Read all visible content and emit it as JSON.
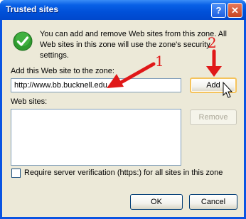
{
  "window": {
    "title": "Trusted sites",
    "help_label": "?",
    "close_label": "✕"
  },
  "info": {
    "icon": "check-circle-icon",
    "text": "You can add and remove Web sites from this zone. All Web sites in this zone will use the zone's security settings."
  },
  "add_section": {
    "label": "Add this Web site to the zone:",
    "url_value": "http://www.bb.bucknell.edu",
    "add_label": "Add"
  },
  "sites_section": {
    "label": "Web sites:",
    "remove_label": "Remove",
    "items": []
  },
  "verification": {
    "checked": false,
    "label": "Require server verification (https:) for all sites in this zone"
  },
  "footer": {
    "ok_label": "OK",
    "cancel_label": "Cancel"
  },
  "annotations": {
    "step1": "1",
    "step2": "2",
    "color": "#e01818"
  },
  "colors": {
    "titlebar": "#0054e3",
    "dialog_bg": "#ece9d8",
    "arrow": "#e01818"
  }
}
